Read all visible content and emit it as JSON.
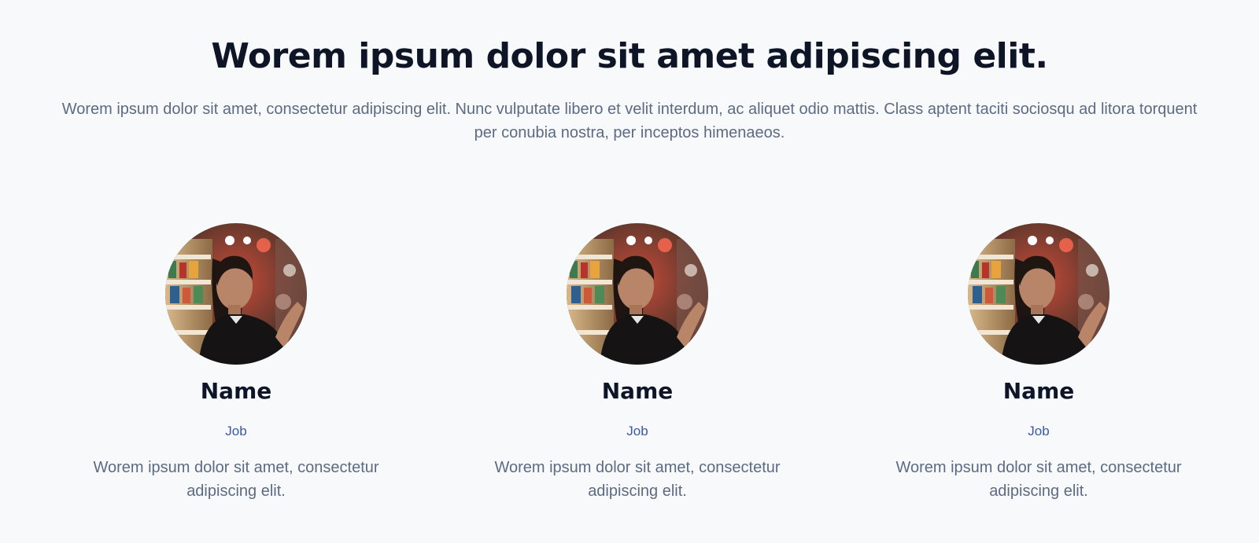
{
  "header": {
    "title": "Worem ipsum dolor sit amet adipiscing elit.",
    "description": "Worem ipsum dolor sit amet, consectetur adipiscing elit. Nunc vulputate libero et velit interdum, ac aliquet odio mattis. Class aptent taciti sociosqu ad litora torquent per conubia nostra, per inceptos himenaeos."
  },
  "team": {
    "members": [
      {
        "name": "Name",
        "job": "Job",
        "bio": "Worem ipsum dolor sit amet, consectetur adipiscing elit.",
        "avatar_icon": "portrait-photo"
      },
      {
        "name": "Name",
        "job": "Job",
        "bio": "Worem ipsum dolor sit amet, consectetur adipiscing elit.",
        "avatar_icon": "portrait-photo"
      },
      {
        "name": "Name",
        "job": "Job",
        "bio": "Worem ipsum dolor sit amet, consectetur adipiscing elit.",
        "avatar_icon": "portrait-photo"
      }
    ]
  },
  "colors": {
    "background": "#f8f9fb",
    "heading": "#0d1526",
    "body_text": "#5d6b82",
    "accent": "#3d56a6"
  }
}
